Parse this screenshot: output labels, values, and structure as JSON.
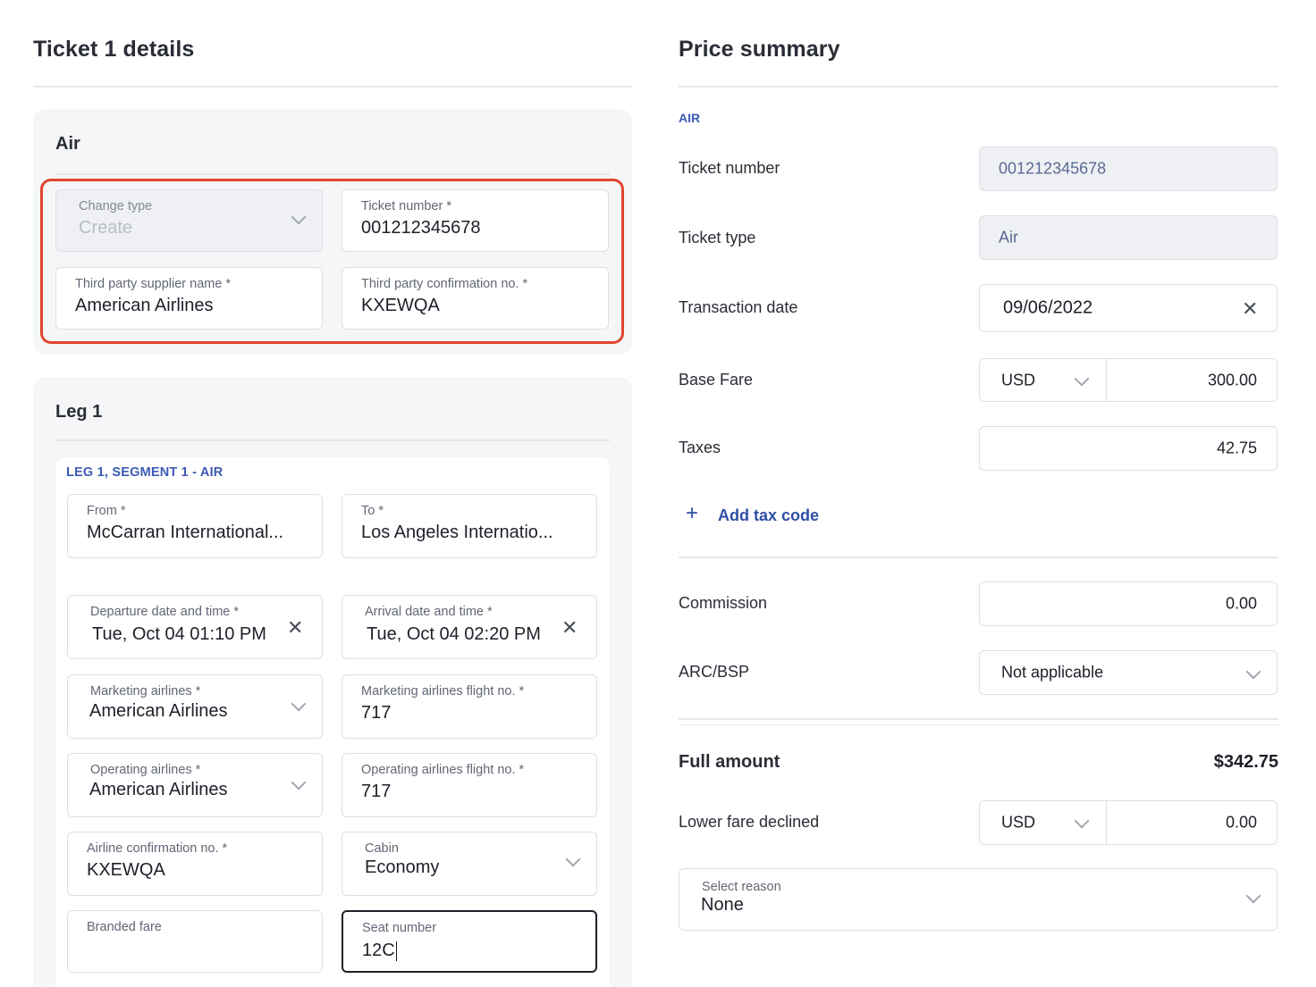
{
  "ticket": {
    "title": "Ticket 1 details",
    "air_card": {
      "title": "Air",
      "change_type": {
        "label": "Change type",
        "value": "Create"
      },
      "ticket_number": {
        "label": "Ticket number *",
        "value": "001212345678"
      },
      "supplier_name": {
        "label": "Third party supplier name *",
        "value": "American Airlines"
      },
      "confirmation_no": {
        "label": "Third party confirmation no. *",
        "value": "KXEWQA"
      }
    },
    "leg_card": {
      "title": "Leg 1",
      "segment_label": "LEG 1, SEGMENT 1 - AIR",
      "from": {
        "label": "From *",
        "value": "McCarran International..."
      },
      "to": {
        "label": "To *",
        "value": "Los Angeles Internatio..."
      },
      "departure": {
        "label": "Departure date and time *",
        "value": "Tue, Oct 04 01:10 PM"
      },
      "arrival": {
        "label": "Arrival date and time *",
        "value": "Tue, Oct 04 02:20 PM"
      },
      "marketing_airline": {
        "label": "Marketing airlines *",
        "value": "American Airlines"
      },
      "marketing_flight": {
        "label": "Marketing airlines flight no. *",
        "value": "717"
      },
      "operating_airline": {
        "label": "Operating airlines *",
        "value": "American Airlines"
      },
      "operating_flight": {
        "label": "Operating airlines flight no. *",
        "value": "717"
      },
      "airline_confirmation": {
        "label": "Airline confirmation no. *",
        "value": "KXEWQA"
      },
      "cabin": {
        "label": "Cabin",
        "value": "Economy"
      },
      "branded_fare": {
        "label": "Branded fare",
        "value": ""
      },
      "seat_number": {
        "label": "Seat number",
        "value": "12C"
      }
    }
  },
  "price_summary": {
    "title": "Price summary",
    "section_tag": "AIR",
    "ticket_number": {
      "label": "Ticket number",
      "value": "001212345678"
    },
    "ticket_type": {
      "label": "Ticket type",
      "value": "Air"
    },
    "transaction_date": {
      "label": "Transaction date",
      "value": "09/06/2022"
    },
    "base_fare": {
      "label": "Base Fare",
      "currency": "USD",
      "value": "300.00"
    },
    "taxes": {
      "label": "Taxes",
      "value": "42.75"
    },
    "add_tax_code": "Add tax code",
    "commission": {
      "label": "Commission",
      "value": "0.00"
    },
    "arc_bsp": {
      "label": "ARC/BSP",
      "value": "Not applicable"
    },
    "full_amount": {
      "label": "Full amount",
      "value": "$342.75"
    },
    "lower_fare_declined": {
      "label": "Lower fare declined",
      "currency": "USD",
      "value": "0.00"
    },
    "select_reason": {
      "label": "Select reason",
      "value": "None"
    }
  },
  "colors": {
    "highlight": "#e0452f",
    "accent": "#3b5bb5",
    "card_bg": "#f5f6f8"
  },
  "icons": [
    "chevron-down-icon",
    "close-icon",
    "plus-icon"
  ]
}
